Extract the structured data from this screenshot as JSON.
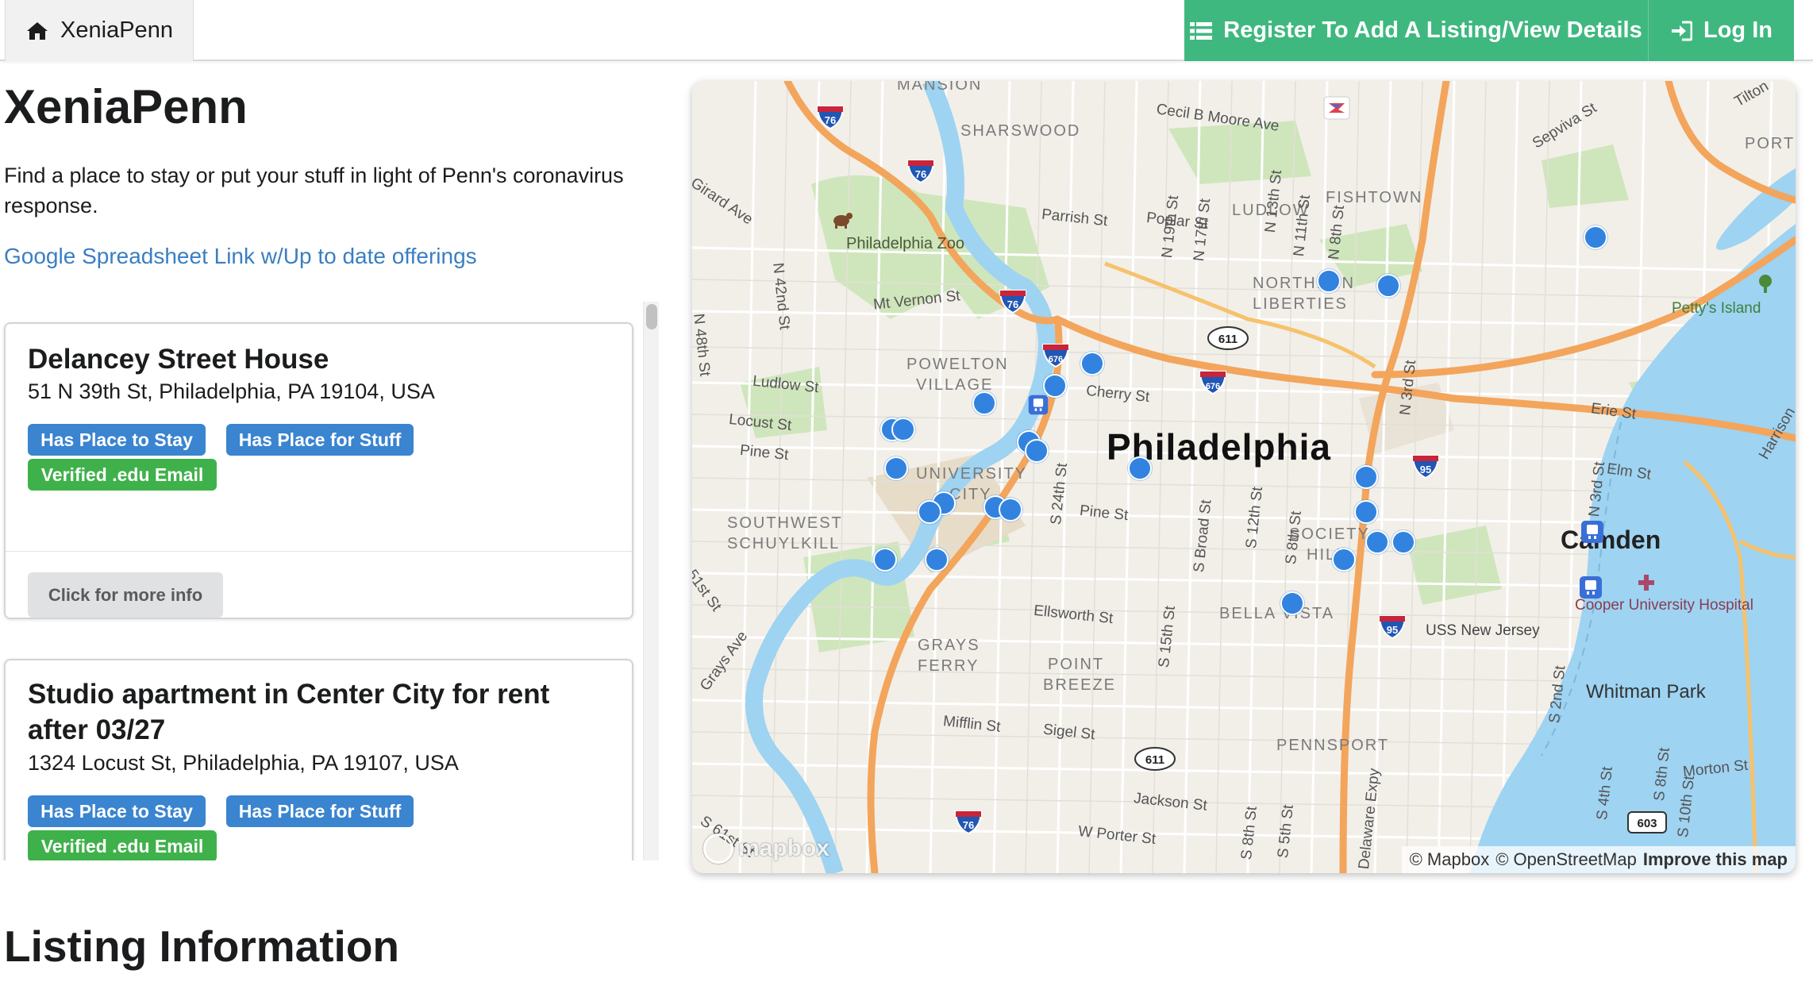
{
  "nav": {
    "home_label": "XeniaPenn",
    "register_label": "Register To Add A Listing/View Details",
    "login_label": "Log In",
    "accent_color": "#3fb880"
  },
  "main": {
    "title": "XeniaPenn",
    "intro": "Find a place to stay or put your stuff in light of Penn's coronavirus response.",
    "sheet_link": "Google Spreadsheet Link w/Up to date offerings",
    "section_title": "Listing Information"
  },
  "listings": [
    {
      "title": "Delancey Street House",
      "address": "51 N 39th St, Philadelphia, PA 19104, USA",
      "tags": [
        "Has Place to Stay",
        "Has Place for Stuff",
        "Verified .edu Email"
      ],
      "more_label": "Click for more info"
    },
    {
      "title": "Studio apartment in Center City for rent after 03/27",
      "address": "1324 Locust St, Philadelphia, PA 19107, USA",
      "tags": [
        "Has Place to Stay",
        "Has Place for Stuff",
        "Verified .edu Email"
      ]
    }
  ],
  "map": {
    "city_label": "Philadelphia",
    "camden_label": "Camden",
    "areas": [
      "MANSION",
      "SHARSWOOD",
      "LUDLOW",
      "FISHTOWN",
      "NORTHERN",
      "LIBERTIES",
      "POWELTON",
      "VILLAGE",
      "UNIVERSITY",
      "CITY",
      "SOUTHWEST",
      "SCHUYLKILL",
      "SOCIETY",
      "HILL",
      "BELLA VISTA",
      "GRAYS",
      "FERRY",
      "POINT",
      "BREEZE",
      "PENNSPORT"
    ],
    "streets": [
      "Cecil B Moore Ave",
      "Parrish St",
      "Poplar St",
      "Mt Vernon St",
      "Ludlow St",
      "Locust St",
      "Pine St",
      "Cherry St",
      "Pine St",
      "Ellsworth St",
      "Mifflin St",
      "Sigel St",
      "Jackson St",
      "W Porter St",
      "Erie St",
      "Elm St",
      "Morton St",
      "Sepviva St",
      "Tilton",
      "N 48th St",
      "N 42nd St",
      "N 19th St",
      "N 17th St",
      "N 13th St",
      "N 11th St",
      "N 8th St",
      "N 3rd St",
      "S 24th St",
      "S Broad St",
      "S 12th St",
      "S 8th St",
      "S 15th St",
      "S 8th St",
      "S 5th St",
      "S 2nd St",
      "S 4th St",
      "S 8th St",
      "S 10th St",
      "N 3rd St",
      "Harrison",
      "51st St",
      "Grays Ave",
      "S 61st St",
      "Girard Ave",
      "Delaware Expy"
    ],
    "places": [
      "Philadelphia Zoo",
      "Petty's Island",
      "Cooper University Hospital",
      "USS New Jersey",
      "Whitman Park",
      "PORT RICHMOND"
    ],
    "shields": [
      "76",
      "76",
      "76",
      "76",
      "676",
      "676",
      "95",
      "95",
      "611",
      "611",
      "603"
    ],
    "attribution": [
      "© Mapbox",
      "© OpenStreetMap",
      "Improve this map"
    ],
    "logo_text": "mapbox",
    "marker_color": "#3283e0",
    "markers": [
      {
        "lat": 39.972,
        "lon": -75.164
      },
      {
        "lat": 39.9715,
        "lon": -75.156
      },
      {
        "lat": 39.977,
        "lon": -75.128
      },
      {
        "lat": 39.9625,
        "lon": -75.196
      },
      {
        "lat": 39.96,
        "lon": -75.201
      },
      {
        "lat": 39.958,
        "lon": -75.2105
      },
      {
        "lat": 39.955,
        "lon": -75.223
      },
      {
        "lat": 39.955,
        "lon": -75.2215
      },
      {
        "lat": 39.9535,
        "lon": -75.2045
      },
      {
        "lat": 39.9525,
        "lon": -75.2035
      },
      {
        "lat": 39.9505,
        "lon": -75.1895
      },
      {
        "lat": 39.9505,
        "lon": -75.2225
      },
      {
        "lat": 39.9465,
        "lon": -75.216
      },
      {
        "lat": 39.9455,
        "lon": -75.218
      },
      {
        "lat": 39.946,
        "lon": -75.209
      },
      {
        "lat": 39.9458,
        "lon": -75.207
      },
      {
        "lat": 39.9495,
        "lon": -75.159
      },
      {
        "lat": 39.9455,
        "lon": -75.159
      },
      {
        "lat": 39.942,
        "lon": -75.1575
      },
      {
        "lat": 39.942,
        "lon": -75.154
      },
      {
        "lat": 39.94,
        "lon": -75.162
      },
      {
        "lat": 39.94,
        "lon": -75.224
      },
      {
        "lat": 39.94,
        "lon": -75.217
      },
      {
        "lat": 39.935,
        "lon": -75.169
      }
    ]
  }
}
